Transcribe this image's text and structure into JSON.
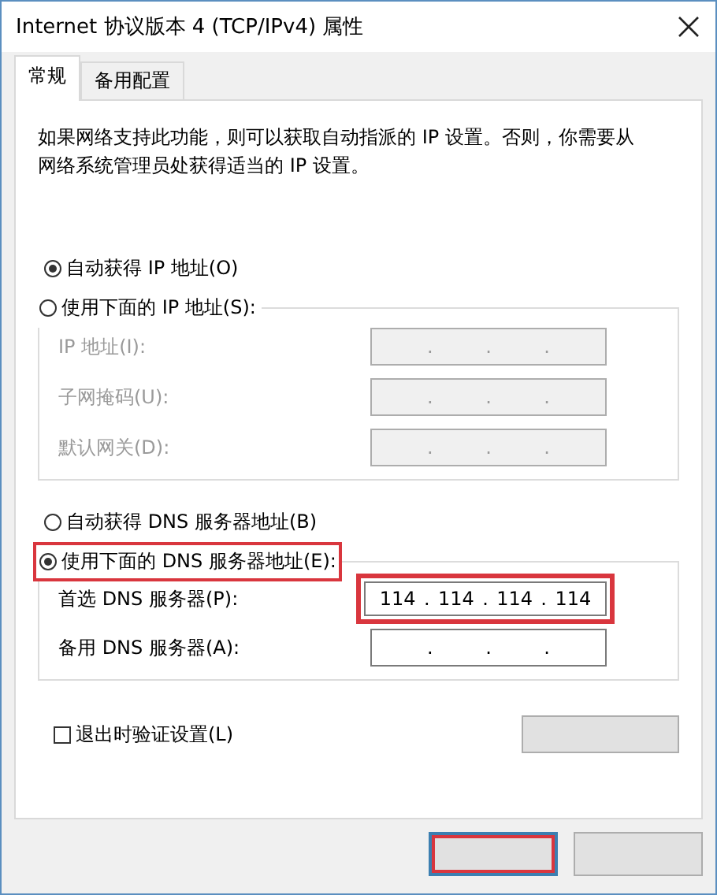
{
  "window": {
    "title": "Internet 协议版本 4 (TCP/IPv4) 属性"
  },
  "tabs": [
    {
      "label": "常规",
      "selected": true
    },
    {
      "label": "备用配置",
      "selected": false
    }
  ],
  "description": "如果网络支持此功能，则可以获取自动指派的 IP 设置。否则，你需要从网络系统管理员处获得适当的 IP 设置。",
  "ip_group": {
    "disabled": true,
    "options": [
      {
        "label": "自动获得 IP 地址(O)",
        "selected": true,
        "highlighted": false
      },
      {
        "label": "使用下面的 IP 地址(S):",
        "selected": false,
        "highlighted": false
      }
    ],
    "fields": [
      {
        "label": "IP 地址(I):",
        "separator": ".",
        "highlighted": false
      },
      {
        "label": "子网掩码(U):",
        "separator": ".",
        "highlighted": false
      },
      {
        "label": "默认网关(D):",
        "separator": ".",
        "highlighted": false
      }
    ]
  },
  "dns_group": {
    "disabled": false,
    "options": [
      {
        "label": "自动获得 DNS 服务器地址(B)",
        "selected": false,
        "highlighted": false
      },
      {
        "label": "使用下面的 DNS 服务器地址(E):",
        "selected": true,
        "highlighted": true
      }
    ],
    "fields": [
      {
        "label": "首选 DNS 服务器(P):",
        "separator": ".",
        "octets": [
          "114",
          "114",
          "114",
          "114"
        ],
        "highlighted": true
      },
      {
        "label": "备用 DNS 服务器(A):",
        "separator": ".",
        "highlighted": false
      }
    ]
  },
  "validate": {
    "label": "退出时验证设置(L)",
    "checked": false
  },
  "buttons": [
    {
      "default": true,
      "highlighted": true
    },
    {
      "default": false,
      "highlighted": false
    }
  ]
}
